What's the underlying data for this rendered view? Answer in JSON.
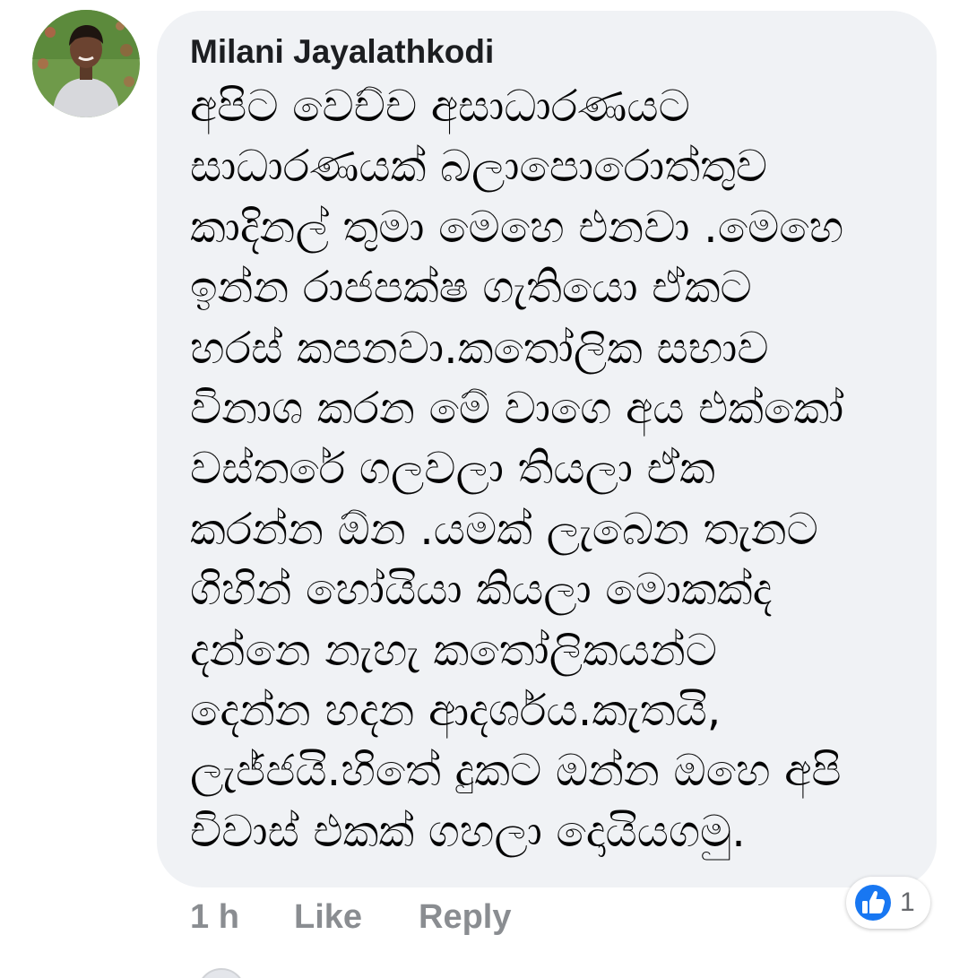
{
  "comment": {
    "author": "Milani Jayalathkodi",
    "lines": [
      "අපිට වෙච්ච අසාධාරණයට",
      "සාධාරණයක් බලාපොරොත්තුව",
      "කාදිනල් තුමා මෙහෙ එනවා .මෙහෙ",
      "ඉන්න රාජපක්ෂ ගැතියො ඒකට",
      "හරස් කපනවා.කතෝලික සභාව",
      "විනාශ කරන මේ වාගෙ අය එක්කෝ",
      "වස්තරේ ගලවලා තියලා ඒක",
      "කරන්න ඕන .යමක් ලැබෙන තැනට",
      "ගිහින් හෝයියා කියලා මොකක්ද",
      "දන්නෙ නැහැ කතෝලිකයන්ට",
      "දෙන්න හදන ආදර්ශය.කැතයි,",
      "ලැජ්ජයි.හිතේ දුකට ඔන්න ඔහෙ අපි",
      "චිවාස් එකක් ගහලා දොයියගමු."
    ]
  },
  "actions": {
    "time": "1 h",
    "like": "Like",
    "reply": "Reply"
  },
  "reactions": {
    "icon": "like-icon",
    "count": "1"
  },
  "colors": {
    "bubble": "#f0f2f5",
    "meta_text": "#8a8d91",
    "like_blue": "#1877f2"
  }
}
